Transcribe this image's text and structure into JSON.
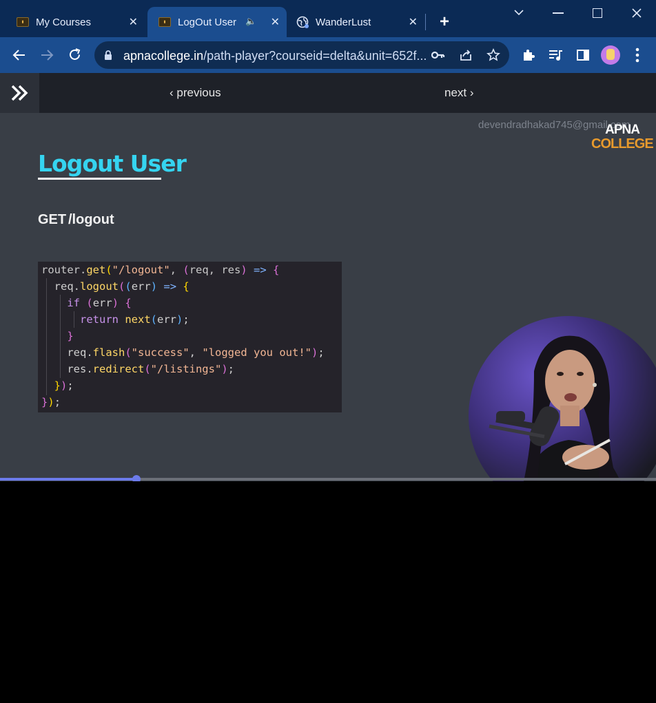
{
  "browser": {
    "tabs": [
      {
        "title": "My Courses",
        "favicon": "college-favicon",
        "active": false
      },
      {
        "title": "LogOut User",
        "favicon": "college-favicon",
        "active": true,
        "audio": true
      },
      {
        "title": "WanderLust",
        "favicon": "globe-icon",
        "active": false
      }
    ],
    "url_host": "apnacollege.in",
    "url_path": "/path-player?courseid=delta&unit=652f..."
  },
  "nav": {
    "previous_label": "previous",
    "next_label": "next"
  },
  "video": {
    "watermark_email": "devendradhakad745@gmail.com",
    "logo_line1": "APNA",
    "logo_line2": "COLLEGE",
    "slide_title": "Logout User",
    "method": "GET",
    "path": "/logout",
    "code_lines": [
      "router.get(\"/logout\", (req, res) => {",
      "  req.logout((err) => {",
      "    if (err) {",
      "      return next(err);",
      "    }",
      "    req.flash(\"success\", \"logged you out!\");",
      "    res.redirect(\"/listings\");",
      "  });",
      "});"
    ],
    "progress": 0.208
  },
  "colors": {
    "tabstrip": "#0b2a55",
    "toolbar": "#1b4d8f",
    "accent_title": "#35d4f0",
    "seek": "#6c7bea"
  }
}
